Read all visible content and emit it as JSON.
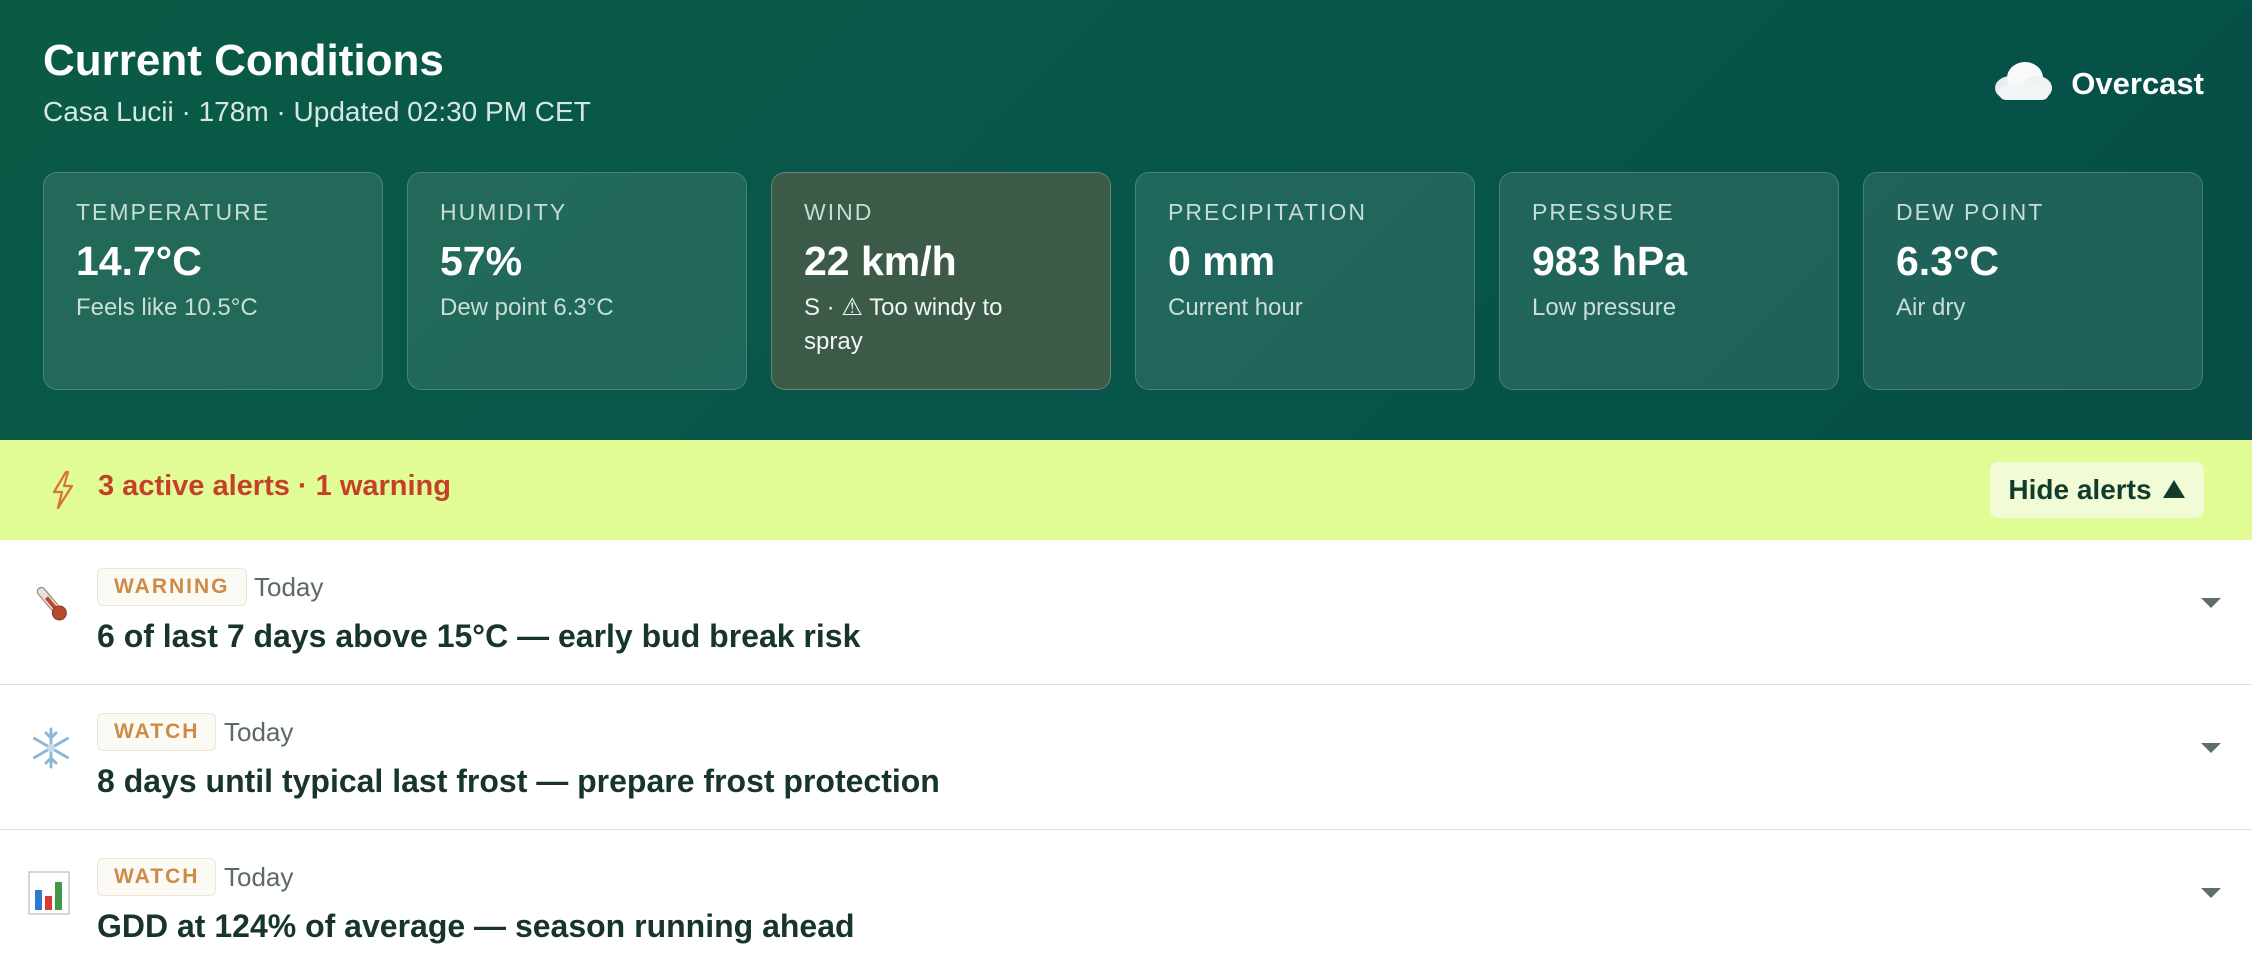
{
  "header": {
    "title": "Current Conditions",
    "subtitle": "Casa Lucii · 178m · Updated 02:30 PM CET",
    "condition": {
      "label": "Overcast",
      "icon": "cloud-icon"
    }
  },
  "cards": [
    {
      "label": "TEMPERATURE",
      "value": "14.7°C",
      "sub": "Feels like 10.5°C"
    },
    {
      "label": "HUMIDITY",
      "value": "57%",
      "sub": "Dew point 6.3°C"
    },
    {
      "label": "WIND",
      "value": "22 km/h",
      "sub_line1": "S · ⚠ Too windy to",
      "sub_line2": "spray"
    },
    {
      "label": "PRECIPITATION",
      "value": "0 mm",
      "sub": "Current hour"
    },
    {
      "label": "PRESSURE",
      "value": "983 hPa",
      "sub": "Low pressure"
    },
    {
      "label": "DEW POINT",
      "value": "6.3°C",
      "sub": "Air dry"
    }
  ],
  "alerts_bar": {
    "summary": "3 active alerts · 1 warning",
    "toggle_label": "Hide alerts",
    "icon": "lightning-icon"
  },
  "alerts": [
    {
      "level": "WARNING",
      "when": "Today",
      "title": "6 of last 7 days above 15°C — early bud break risk",
      "icon": "thermometer-icon"
    },
    {
      "level": "WATCH",
      "when": "Today",
      "title": "8 days until typical last frost — prepare frost protection",
      "icon": "snowflake-icon"
    },
    {
      "level": "WATCH",
      "when": "Today",
      "title": "GDD at 124% of average — season running ahead",
      "icon": "bar-chart-icon"
    }
  ],
  "colors": {
    "header_bg": "#07564a",
    "alert_bar_bg": "#e1fb95",
    "alert_text": "#c5402a",
    "badge_text": "#cd8b46"
  }
}
